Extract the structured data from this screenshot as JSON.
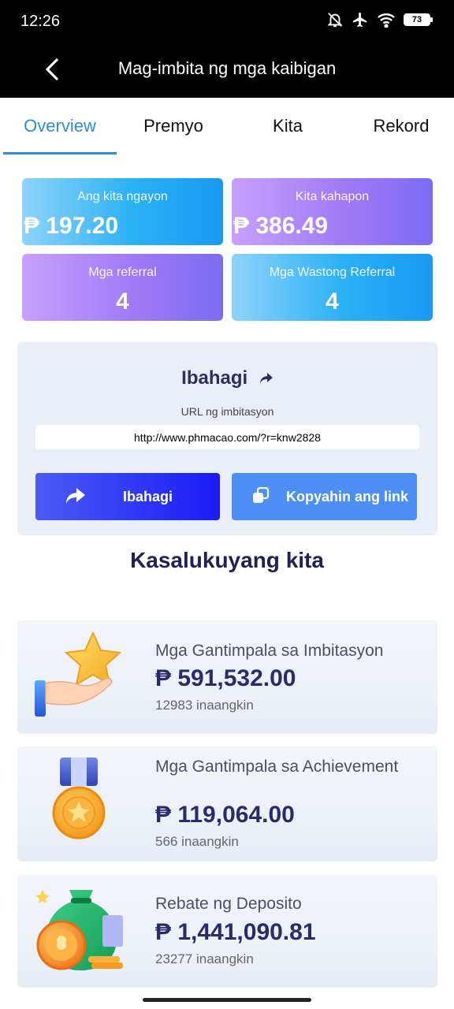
{
  "status_bar": {
    "time": "12:26",
    "battery": "73"
  },
  "app_bar": {
    "title": "Mag-imbita ng mga kaibigan"
  },
  "tabs": [
    {
      "label": "Overview",
      "active": true
    },
    {
      "label": "Premyo",
      "active": false
    },
    {
      "label": "Kita",
      "active": false
    },
    {
      "label": "Rekord",
      "active": false
    }
  ],
  "stats": {
    "today": {
      "label": "Ang kita ngayon",
      "value": "₱ 197.20"
    },
    "yesterday": {
      "label": "Kita kahapon",
      "value": "₱ 386.49"
    },
    "referrals": {
      "label": "Mga referral",
      "value": "4"
    },
    "valid_referrals": {
      "label": "Mga Wastong Referral",
      "value": "4"
    }
  },
  "share": {
    "title": "Ibahagi",
    "url_label": "URL ng imbitasyon",
    "url": "http://www.phmacao.com/?r=knw2828",
    "share_button": "Ibahagi",
    "copy_button": "Kopyahin ang link"
  },
  "earnings": {
    "title": "Kasalukuyang kita",
    "items": [
      {
        "title": "Mga Gantimpala sa Imbitasyon",
        "amount": "₱ 591,532.00",
        "count": "12983 inaangkin",
        "icon": "hand-star-icon"
      },
      {
        "title": "Mga Gantimpala sa Achievement",
        "amount": "₱ 119,064.00",
        "count": "566 inaangkin",
        "icon": "medal-icon"
      },
      {
        "title": "Rebate ng Deposito",
        "amount": "₱ 1,441,090.81",
        "count": "23277 inaangkin",
        "icon": "money-bag-icon"
      }
    ]
  },
  "colors": {
    "accent": "#2e8bd8",
    "dark_text": "#2a2a6c",
    "share_button": "#1b1cf5",
    "copy_button": "#4d8ff5"
  }
}
